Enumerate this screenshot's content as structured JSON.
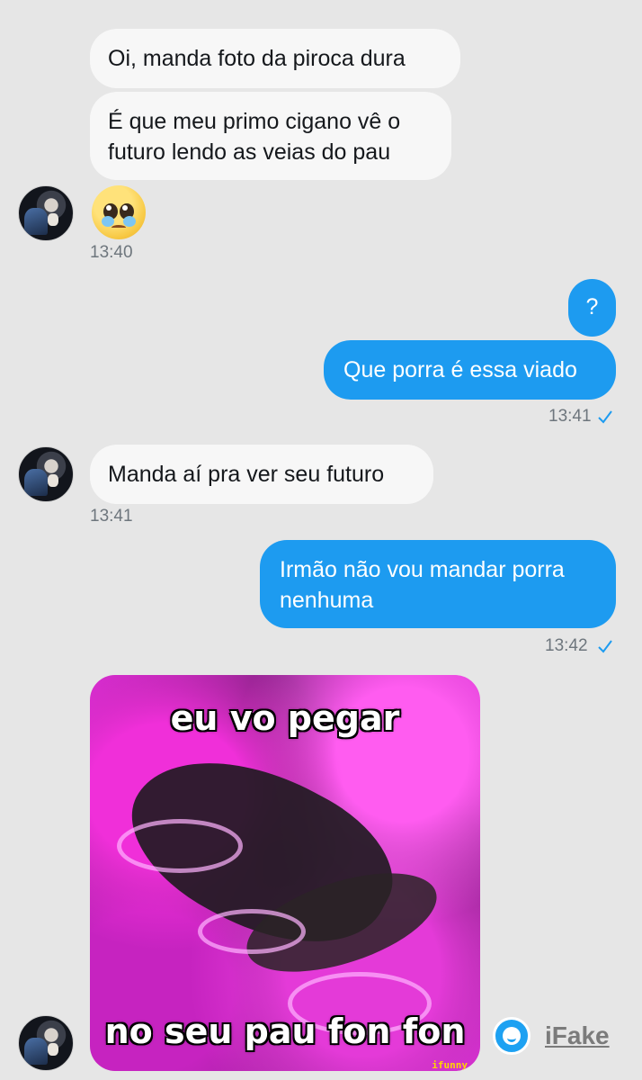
{
  "conversation": {
    "messages_in_1": [
      "Oi, manda foto da piroca dura",
      "É que meu primo cigano vê o",
      "futuro lendo as veias do pau"
    ],
    "time_1": "13:40",
    "out_1": "?",
    "out_2": "Que porra é essa viado",
    "time_2": "13:41",
    "in_2": "Manda aí pra ver seu futuro",
    "time_3": "13:41",
    "out_3_line1": "Irmão não vou mandar porra",
    "out_3_line2": "nenhuma",
    "time_4": "13:42",
    "meme_top": "eu vo pegar",
    "meme_bottom": "no seu pau fon fon",
    "meme_watermark": "ifunny"
  },
  "watermark": {
    "label": "iFake",
    "icon": "smiley-icon"
  },
  "colors": {
    "background": "#e6e6e6",
    "incoming_bubble": "#f7f7f7",
    "outgoing_bubble": "#1d9bf0",
    "timestamp": "#6e767d",
    "check": "#1d9bf0"
  }
}
